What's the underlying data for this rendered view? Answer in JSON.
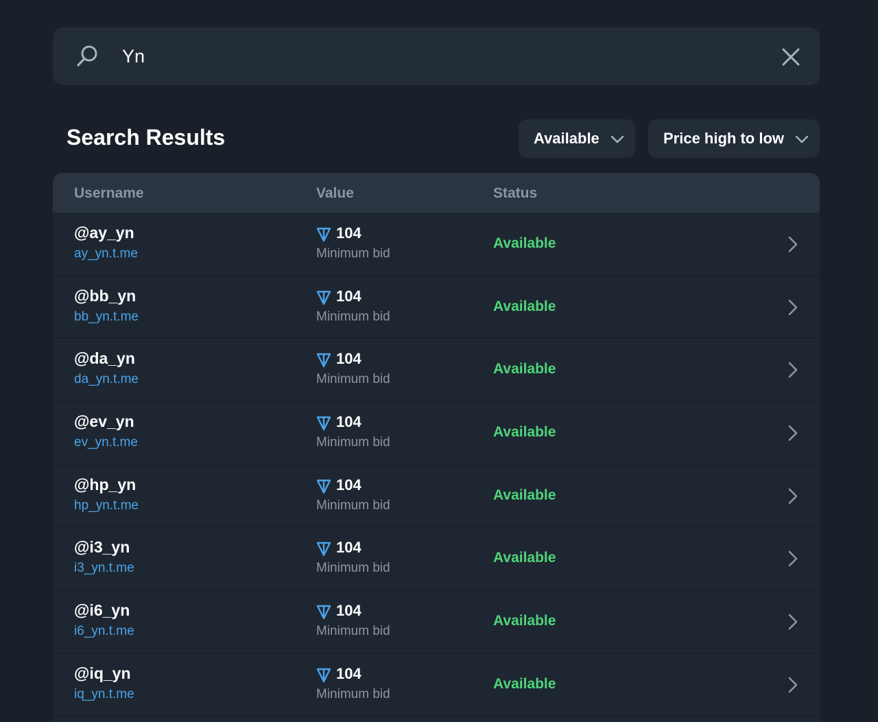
{
  "search": {
    "value": "Yn",
    "icon": "search-icon",
    "clear_icon": "close-icon"
  },
  "page_title": "Search Results",
  "filters": {
    "status_label": "Available",
    "sort_label": "Price high to low"
  },
  "table": {
    "columns": [
      "Username",
      "Value",
      "Status"
    ],
    "rows": [
      {
        "username": "@ay_yn",
        "link": "ay_yn.t.me",
        "value": "104",
        "value_sub": "Minimum bid",
        "status": "Available"
      },
      {
        "username": "@bb_yn",
        "link": "bb_yn.t.me",
        "value": "104",
        "value_sub": "Minimum bid",
        "status": "Available"
      },
      {
        "username": "@da_yn",
        "link": "da_yn.t.me",
        "value": "104",
        "value_sub": "Minimum bid",
        "status": "Available"
      },
      {
        "username": "@ev_yn",
        "link": "ev_yn.t.me",
        "value": "104",
        "value_sub": "Minimum bid",
        "status": "Available"
      },
      {
        "username": "@hp_yn",
        "link": "hp_yn.t.me",
        "value": "104",
        "value_sub": "Minimum bid",
        "status": "Available"
      },
      {
        "username": "@i3_yn",
        "link": "i3_yn.t.me",
        "value": "104",
        "value_sub": "Minimum bid",
        "status": "Available"
      },
      {
        "username": "@i6_yn",
        "link": "i6_yn.t.me",
        "value": "104",
        "value_sub": "Minimum bid",
        "status": "Available"
      },
      {
        "username": "@iq_yn",
        "link": "iq_yn.t.me",
        "value": "104",
        "value_sub": "Minimum bid",
        "status": "Available"
      }
    ]
  },
  "colors": {
    "background": "#1a2029",
    "panel": "#232d38",
    "accent_link": "#4ba3ea",
    "status_available": "#4fd47a",
    "muted_text": "#8c96a2"
  }
}
